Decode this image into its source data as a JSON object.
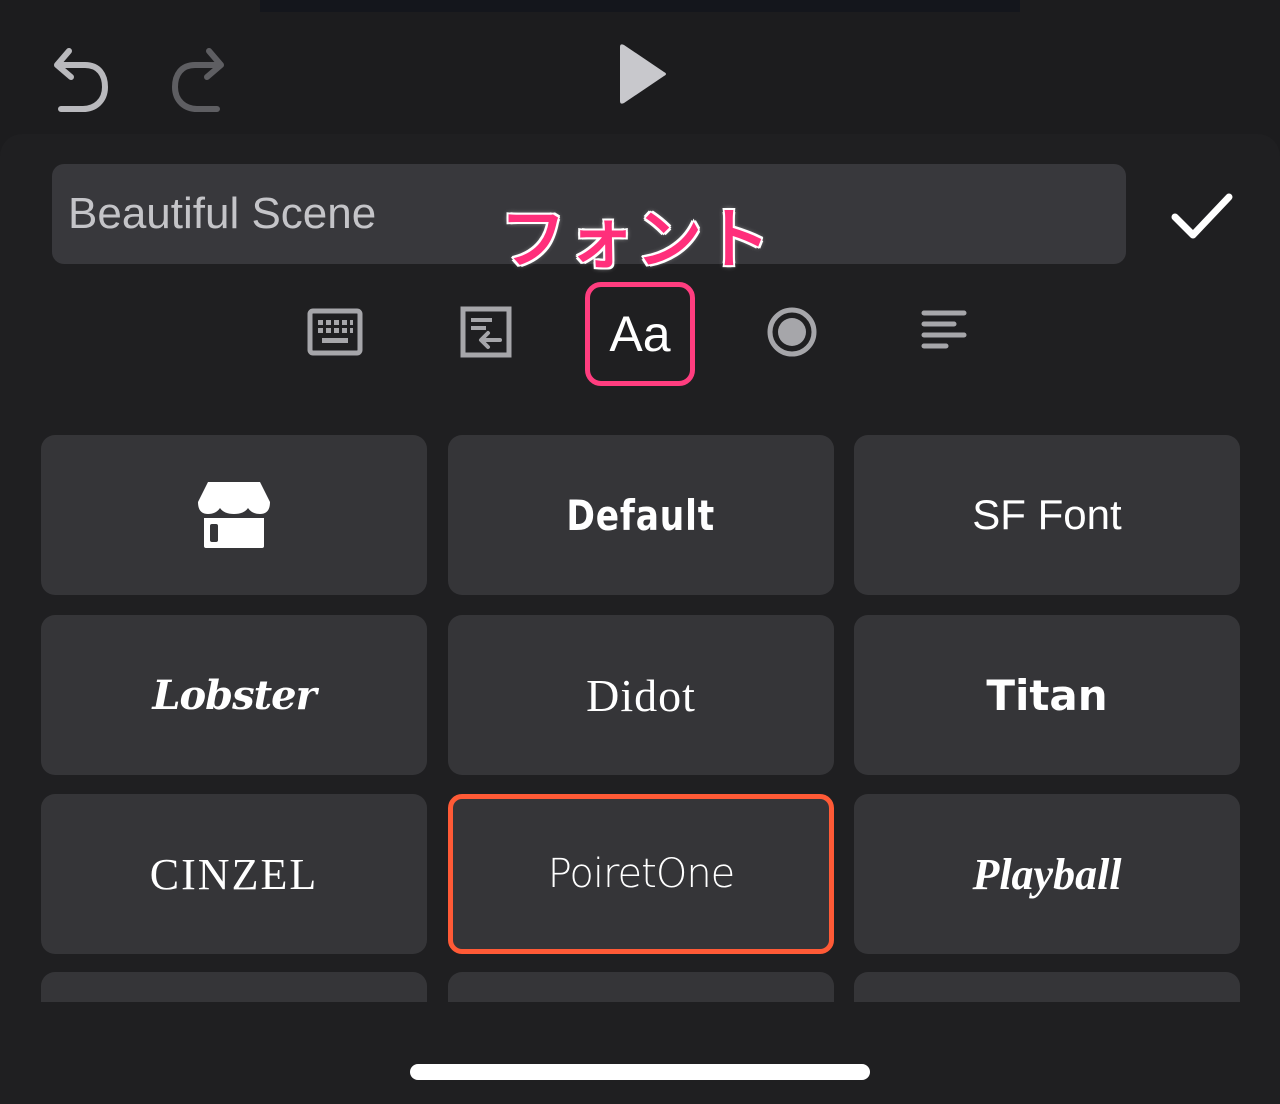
{
  "toolbar": {
    "undo_icon": "undo-arrow-icon",
    "redo_icon": "redo-arrow-icon",
    "play_icon": "play-triangle-icon"
  },
  "editor": {
    "text_value": "Beautiful Scene",
    "confirm_icon": "checkmark-icon"
  },
  "annotation": {
    "label": "フォント",
    "color": "#ff2f7b"
  },
  "tools": {
    "keyboard_icon": "keyboard-icon",
    "import_icon": "text-import-icon",
    "font_label": "Aa",
    "color_icon": "color-circle-icon",
    "align_icon": "align-left-icon",
    "active_color": "#ff3d7f"
  },
  "fonts": {
    "store_icon": "font-store-icon",
    "items": [
      {
        "label": "Default"
      },
      {
        "label": "SF Font"
      },
      {
        "label": "Lobster"
      },
      {
        "label": "Didot"
      },
      {
        "label": "Titan"
      },
      {
        "label": "CINZEL"
      },
      {
        "label": "PoiretOne"
      },
      {
        "label": "Playball"
      }
    ],
    "selected": "PoiretOne",
    "selected_color": "#ff5a36"
  }
}
